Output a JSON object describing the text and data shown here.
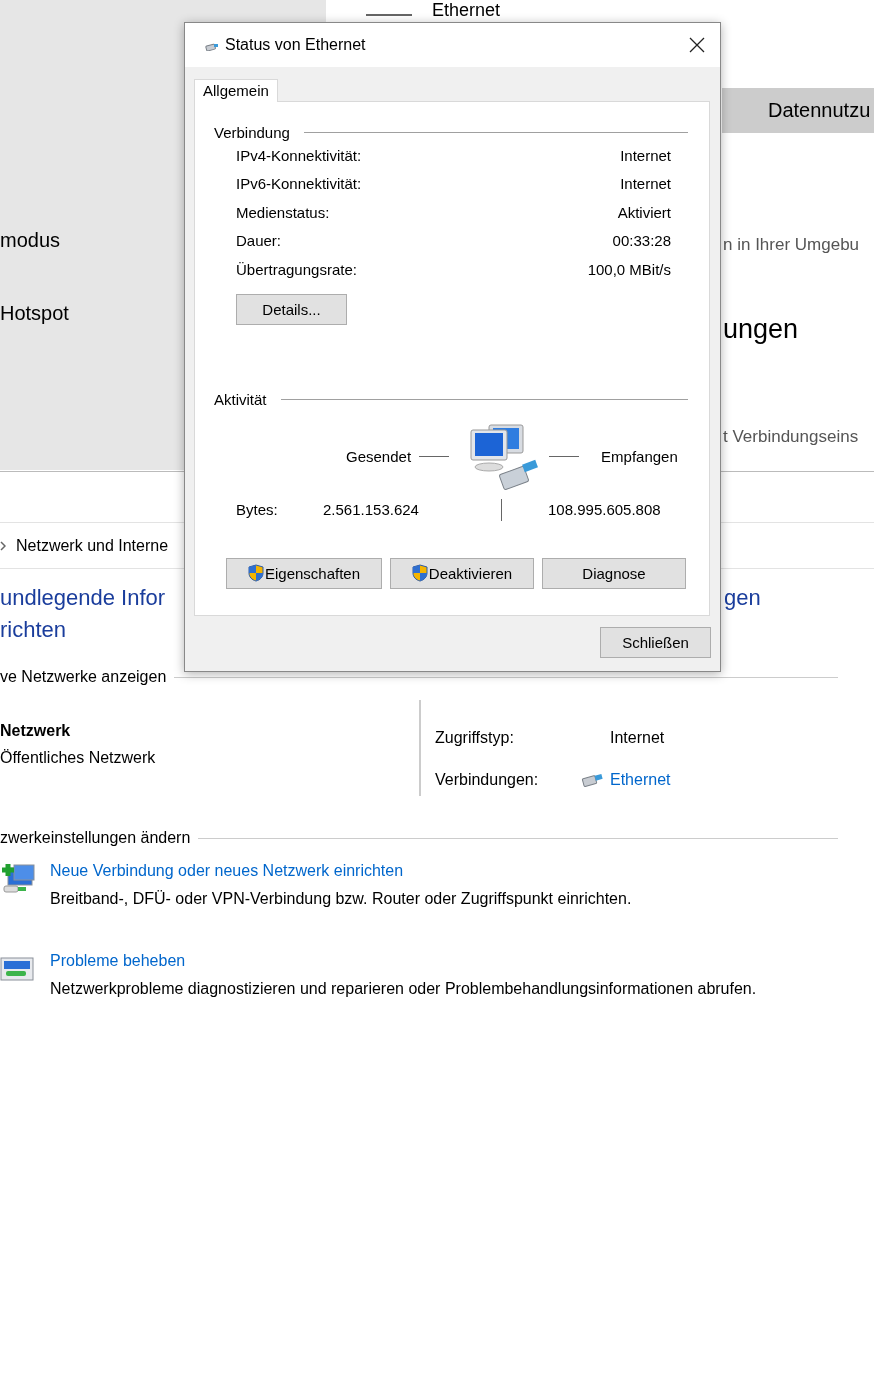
{
  "settings_window": {
    "title": "Ethernet",
    "sidebar": [
      {
        "label": "modus"
      },
      {
        "label": "Hotspot"
      }
    ],
    "data_usage_tab": "Datennutzu",
    "nearby_text": "n in Ihrer Umgebu",
    "heading": "ungen",
    "settings_link": "t Verbindungseins"
  },
  "control_panel": {
    "breadcrumb": "Netzwerk und Interne",
    "heading_lines": [
      "undlegende Infor",
      "richten"
    ],
    "heading_tail": "gen",
    "active_networks": {
      "section": "ve Netzwerke anzeigen",
      "network_name": "Netzwerk",
      "network_type": "Öffentliches Netzwerk",
      "access_label": "Zugriffstyp:",
      "access_value": "Internet",
      "connections_label": "Verbindungen:",
      "connection_link": "Ethernet"
    },
    "change_settings": {
      "section": "zwerkeinstellungen ändern",
      "tasks": [
        {
          "kind": "new",
          "title": "Neue Verbindung oder neues Netzwerk einrichten",
          "description": "Breitband-, DFÜ- oder VPN-Verbindung bzw. Router oder Zugriffspunkt einrichten."
        },
        {
          "kind": "troubleshoot",
          "title": "Probleme beheben",
          "description": "Netzwerkprobleme diagnostizieren und reparieren oder Problembehandlungsinformationen abrufen."
        }
      ]
    }
  },
  "dialog": {
    "title": "Status von Ethernet",
    "tabs": [
      {
        "label": "Allgemein",
        "selected": true
      }
    ],
    "connection": {
      "heading": "Verbindung",
      "rows": [
        {
          "label": "IPv4-Konnektivität:",
          "value": "Internet"
        },
        {
          "label": "IPv6-Konnektivität:",
          "value": "Internet"
        },
        {
          "label": "Medienstatus:",
          "value": "Aktiviert"
        },
        {
          "label": "Dauer:",
          "value": "00:33:28"
        },
        {
          "label": "Übertragungsrate:",
          "value": "100,0 MBit/s"
        }
      ]
    },
    "details_button": "Details...",
    "activity": {
      "heading": "Aktivität",
      "sent_label": "Gesendet",
      "received_label": "Empfangen",
      "bytes_label": "Bytes:",
      "sent": "2.561.153.624",
      "received": "108.995.605.808"
    },
    "buttons": [
      {
        "label": "Eigenschaften",
        "shield": true
      },
      {
        "label": "Deaktivieren",
        "shield": true
      },
      {
        "label": "Diagnose",
        "shield": false
      }
    ],
    "close_button": "Schließen"
  }
}
